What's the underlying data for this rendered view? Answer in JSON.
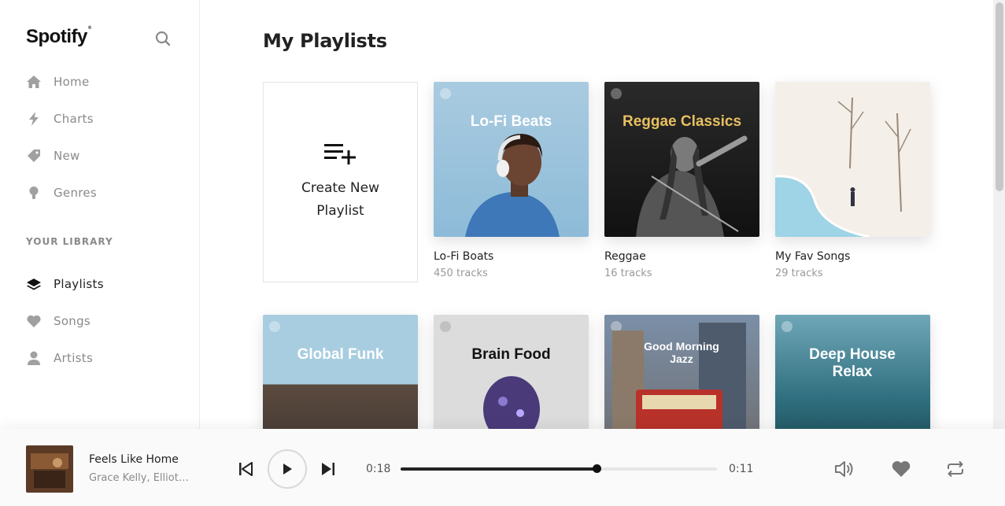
{
  "app": {
    "logo": "Spotify"
  },
  "sidebar": {
    "nav": [
      {
        "label": "Home",
        "icon": "home-icon"
      },
      {
        "label": "Charts",
        "icon": "lightning-icon"
      },
      {
        "label": "New",
        "icon": "tag-icon"
      },
      {
        "label": "Genres",
        "icon": "bulb-icon"
      }
    ],
    "library_title": "YOUR LIBRARY",
    "library": [
      {
        "label": "Playlists",
        "icon": "layers-icon",
        "active": true
      },
      {
        "label": "Songs",
        "icon": "heart-icon"
      },
      {
        "label": "Artists",
        "icon": "user-icon"
      }
    ]
  },
  "main": {
    "title": "My Playlists",
    "create_label": "Create New Playlist",
    "playlists": [
      {
        "cover_title": "Lo-Fi Beats",
        "name": "Lo-Fi Boats",
        "tracks": "450 tracks"
      },
      {
        "cover_title": "Reggae Classics",
        "name": "Reggae",
        "tracks": "16 tracks"
      },
      {
        "cover_title": "",
        "name": "My Fav Songs",
        "tracks": "29 tracks"
      }
    ],
    "playlists_row2": [
      {
        "cover_title": "Global Funk"
      },
      {
        "cover_title": "Brain Food"
      },
      {
        "cover_title": "Good Morning Jazz"
      },
      {
        "cover_title": "Deep House Relax"
      }
    ]
  },
  "player": {
    "title": "Feels Like Home",
    "artist": "Grace Kelly, Elliott ...",
    "elapsed": "0:18",
    "remaining": "0:11",
    "progress": 0.62
  },
  "colors": {
    "accent": "#222222",
    "muted": "#8a8a8a"
  }
}
